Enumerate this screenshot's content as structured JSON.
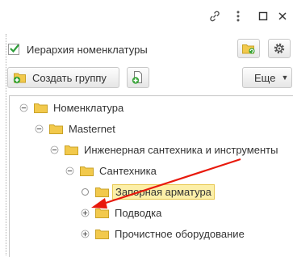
{
  "window": {
    "icons": [
      "link-icon",
      "more-vertical-icon",
      "maximize-icon",
      "close-icon"
    ]
  },
  "filter": {
    "hierarchy_label": "Иерархия номенклатуры",
    "hierarchy_checked": true
  },
  "toolbar": {
    "create_group_label": "Создать группу",
    "more_label": "Еще"
  },
  "tree": {
    "nodes": [
      {
        "label": "Номенклатура",
        "level": 0,
        "expander": "minus"
      },
      {
        "label": "Masternet",
        "level": 1,
        "expander": "minus"
      },
      {
        "label": "Инженерная сантехника и инструменты",
        "level": 2,
        "expander": "minus"
      },
      {
        "label": "Сантехника",
        "level": 3,
        "expander": "minus"
      },
      {
        "label": "Запорная арматура",
        "level": 4,
        "expander": "circle",
        "selected": true
      },
      {
        "label": "Подводка",
        "level": 4,
        "expander": "plus"
      },
      {
        "label": "Прочистное оборудование",
        "level": 4,
        "expander": "plus"
      }
    ]
  },
  "colors": {
    "folder": "#f2c94c",
    "folder_stroke": "#c9a227",
    "plus_green": "#3aa53a",
    "selection_bg": "#fcefa8",
    "selection_border": "#e8c850",
    "annotation_arrow": "#e8190c"
  }
}
